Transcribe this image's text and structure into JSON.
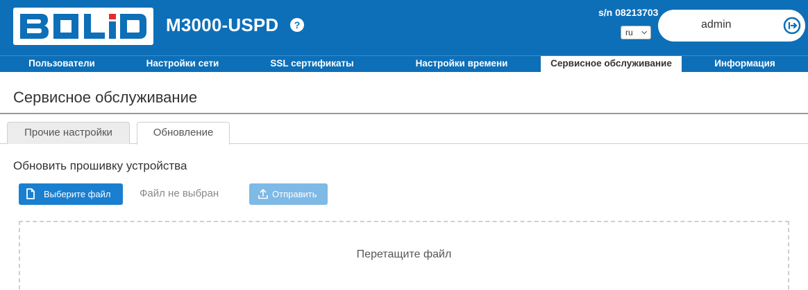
{
  "header": {
    "logo_text": "BOLID",
    "model": "M3000-USPD",
    "help_symbol": "?",
    "serial": "s/n 08213703",
    "language": "ru",
    "user": "admin",
    "colors": {
      "brand": "#0d6fb8",
      "active_nav_bg": "#ffffff"
    }
  },
  "nav": {
    "items": [
      {
        "label": "Пользователи"
      },
      {
        "label": "Настройки сети"
      },
      {
        "label": "SSL сертификаты"
      },
      {
        "label": "Настройки времени"
      },
      {
        "label": "Сервисное обслуживание"
      },
      {
        "label": "Информация"
      }
    ],
    "active": "Сервисное обслуживание"
  },
  "page": {
    "title": "Сервисное обслуживание",
    "tabs": [
      {
        "label": "Прочие настройки"
      },
      {
        "label": "Обновление"
      }
    ],
    "active_tab": "Обновление",
    "section_title": "Обновить прошивку устройства",
    "choose_file_label": "Выберите файл",
    "no_file_label": "Файл не выбран",
    "send_label": "Отправить",
    "dropzone_text": "Перетащите файл"
  },
  "icons": {
    "logo": "bolid-logo",
    "help": "help-icon",
    "logout": "logout-icon",
    "file": "file-icon",
    "upload": "upload-icon",
    "chevron": "chevron-down-icon"
  }
}
